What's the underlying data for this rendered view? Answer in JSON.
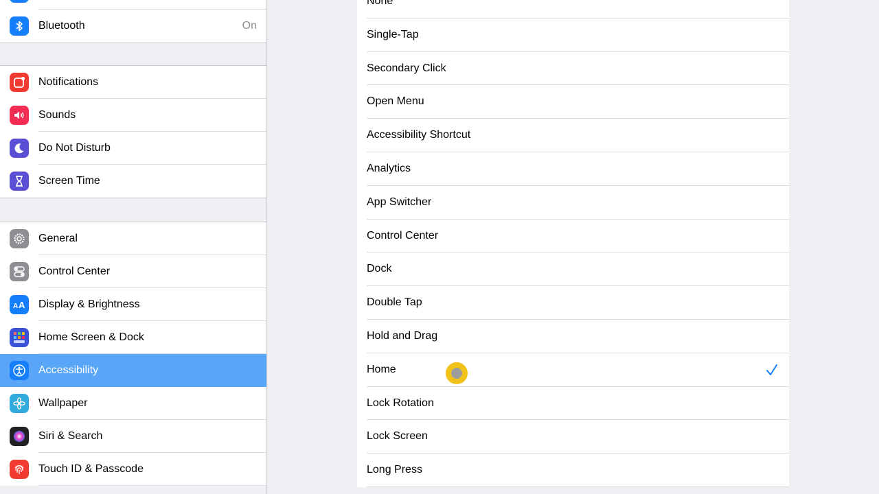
{
  "sidebar": {
    "bluetooth": {
      "label": "Bluetooth",
      "value": "On",
      "icon": "bluetooth-icon",
      "color": "#147efb"
    },
    "group2": [
      {
        "label": "Notifications",
        "icon": "notifications-icon",
        "color": "#f23b30"
      },
      {
        "label": "Sounds",
        "icon": "speaker-icon",
        "color": "#f12d55"
      },
      {
        "label": "Do Not Disturb",
        "icon": "moon-icon",
        "color": "#5b4fd6"
      },
      {
        "label": "Screen Time",
        "icon": "hourglass-icon",
        "color": "#5b4fd6"
      }
    ],
    "group3": [
      {
        "label": "General",
        "icon": "gear-icon",
        "color": "#8e8e93"
      },
      {
        "label": "Control Center",
        "icon": "toggles-icon",
        "color": "#8e8e93"
      },
      {
        "label": "Display & Brightness",
        "icon": "text-size-icon",
        "color": "#147efb"
      },
      {
        "label": "Home Screen & Dock",
        "icon": "app-grid-icon",
        "color": "#3a52d8"
      },
      {
        "label": "Accessibility",
        "icon": "accessibility-icon",
        "color": "#147efb",
        "selected": true
      },
      {
        "label": "Wallpaper",
        "icon": "flower-icon",
        "color": "#33aadc"
      },
      {
        "label": "Siri & Search",
        "icon": "siri-icon",
        "color": "#222"
      },
      {
        "label": "Touch ID & Passcode",
        "icon": "fingerprint-icon",
        "color": "#f23b30"
      }
    ]
  },
  "options": {
    "selected": "Home",
    "items": [
      "None",
      "Single-Tap",
      "Secondary Click",
      "Open Menu",
      "Accessibility Shortcut",
      "Analytics",
      "App Switcher",
      "Control Center",
      "Dock",
      "Double Tap",
      "Hold and Drag",
      "Home",
      "Lock Rotation",
      "Lock Screen",
      "Long Press"
    ]
  },
  "colors": {
    "accent": "#147efb",
    "selection": "#59a5f7",
    "touch_indicator": "#f2c21a"
  }
}
